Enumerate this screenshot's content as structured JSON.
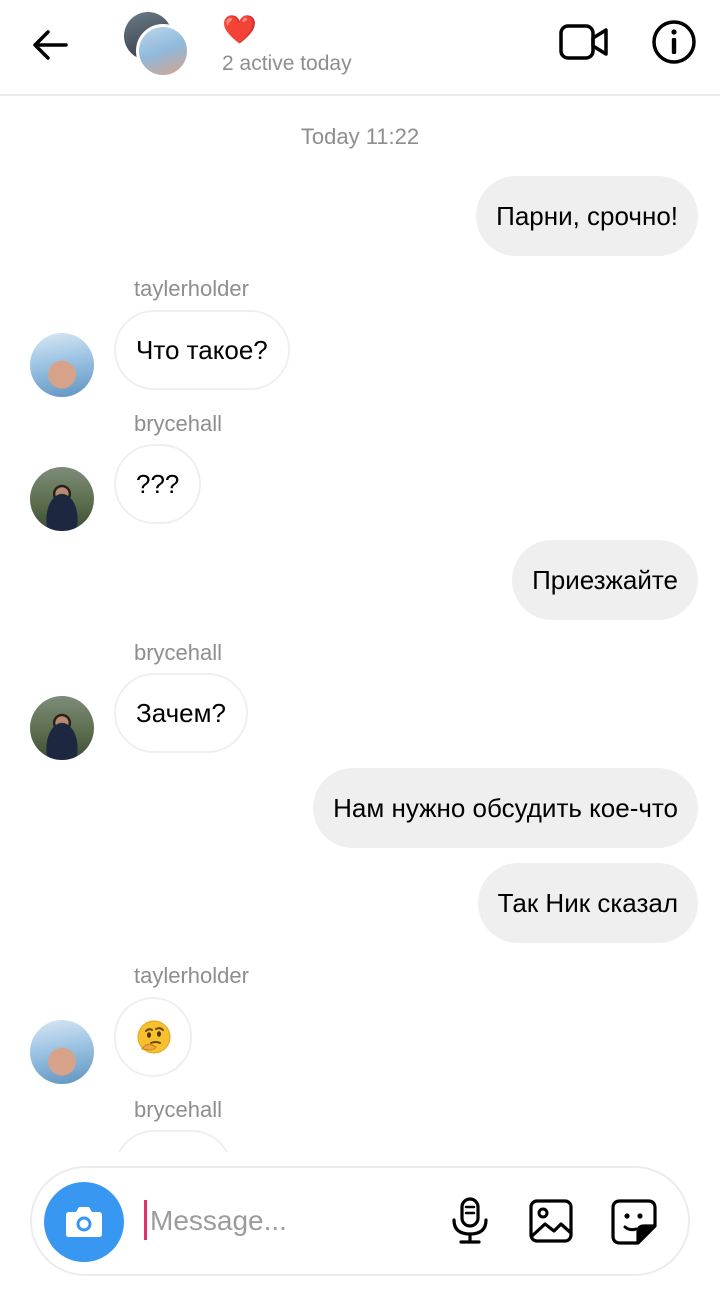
{
  "header": {
    "heart": "❤️",
    "status": "2 active today"
  },
  "chat": {
    "timestamp": "Today 11:22",
    "messages": [
      {
        "text": "Парни, срочно!"
      },
      {
        "sender": "taylerholder",
        "text": "Что такое?"
      },
      {
        "sender": "brycehall",
        "text": "???"
      },
      {
        "text": "Приезжайте"
      },
      {
        "sender": "brycehall",
        "text": "Зачем?"
      },
      {
        "text": "Нам нужно обсудить кое-что"
      },
      {
        "text": "Так Ник сказал"
      },
      {
        "sender": "taylerholder",
        "emoji": "thinking-face"
      },
      {
        "sender": "brycehall"
      }
    ]
  },
  "composer": {
    "placeholder": "Message..."
  },
  "icons": {
    "back": "arrow-left-icon",
    "video": "video-camera-icon",
    "info": "info-icon",
    "camera": "camera-icon",
    "mic": "microphone-icon",
    "gallery": "image-icon",
    "sticker": "sticker-icon"
  },
  "colors": {
    "accent": "#3897f0",
    "cursor": "#e1306c",
    "bubble_outgoing": "#efefef",
    "meta_text": "#8e8e8e"
  }
}
